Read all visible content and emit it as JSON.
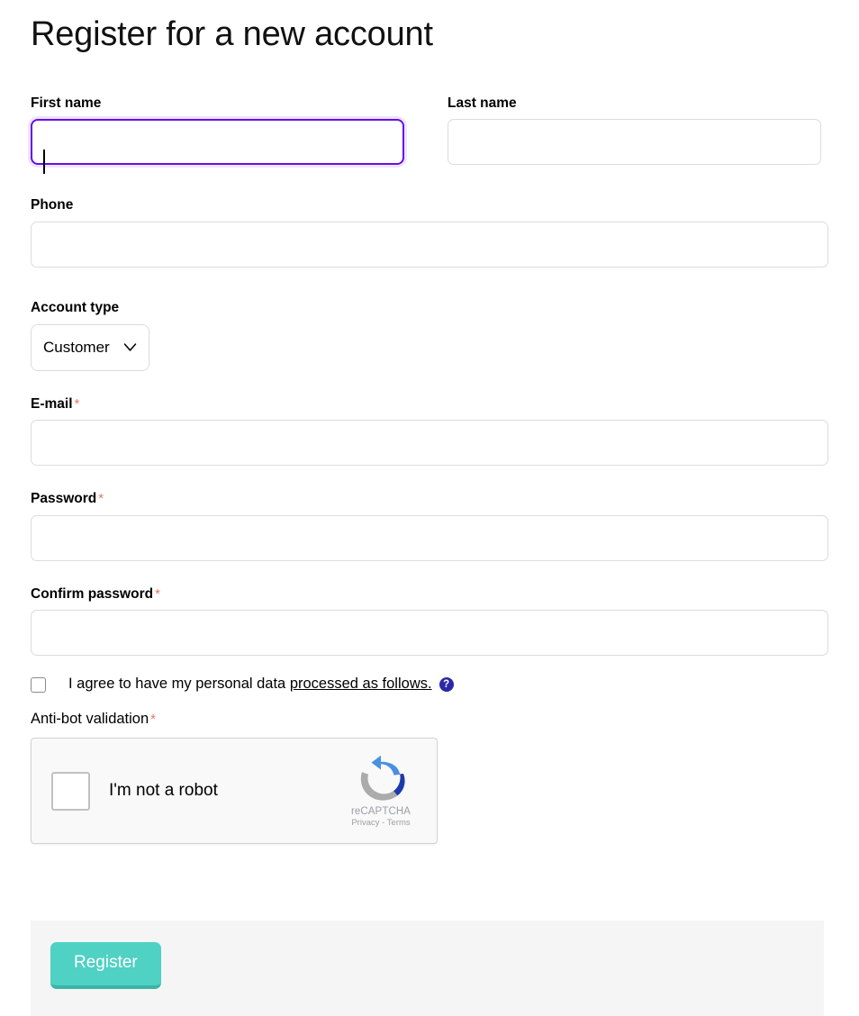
{
  "page": {
    "title": "Register for a new account"
  },
  "fields": {
    "first_name": {
      "label": "First name",
      "value": "",
      "placeholder": ""
    },
    "last_name": {
      "label": "Last name",
      "value": "",
      "placeholder": ""
    },
    "phone": {
      "label": "Phone",
      "value": "",
      "placeholder": ""
    },
    "account_type": {
      "label": "Account type",
      "selected": "Customer",
      "icon": "chevron-down-icon"
    },
    "email": {
      "label": "E-mail",
      "required_marker": "*",
      "value": "",
      "placeholder": ""
    },
    "password": {
      "label": "Password",
      "required_marker": "*",
      "value": "",
      "placeholder": ""
    },
    "confirm_password": {
      "label": "Confirm password",
      "required_marker": "*",
      "value": "",
      "placeholder": ""
    }
  },
  "consent": {
    "text_before": "I agree to have my personal data",
    "link_text": "processed as follows.",
    "help_icon_glyph": "?",
    "help_icon_name": "help-circle-icon",
    "checked": false
  },
  "antibot": {
    "label": "Anti-bot validation",
    "required_marker": "*",
    "captcha": {
      "checkbox_label": "I'm not a robot",
      "brand": "reCAPTCHA",
      "privacy": "Privacy",
      "separator": "-",
      "terms": "Terms",
      "logo_name": "recaptcha-logo-icon",
      "checked": false
    }
  },
  "footer": {
    "submit_label": "Register"
  },
  "colors": {
    "focus_border": "#6410e8",
    "focus_glow": "#efe4ff",
    "required_asterisk": "#e07a63",
    "submit_bg": "#4fd1c3",
    "submit_shadow": "#3cb3a7",
    "help_icon_bg": "#2b28a8",
    "footer_bg": "#f5f5f5",
    "input_border": "#dcdcdc",
    "captcha_bg": "#f9f9f9"
  }
}
